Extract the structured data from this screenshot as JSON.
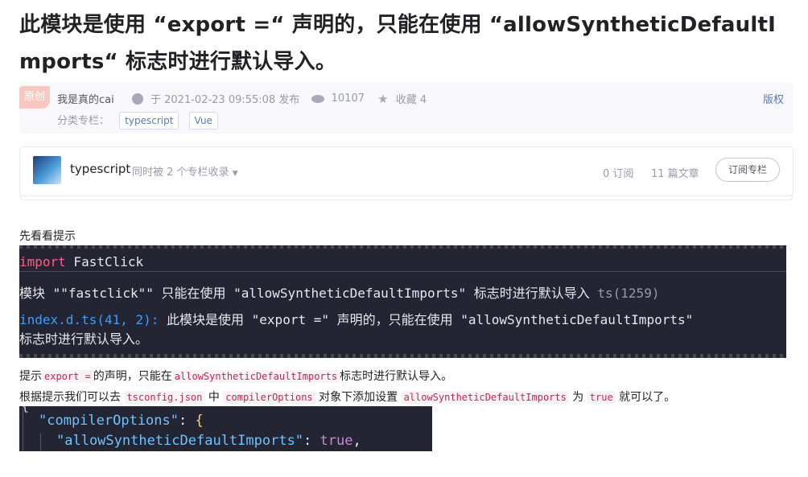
{
  "article": {
    "title": "此模块是使用 “export =“ 声明的，只能在使用 “allowSyntheticDefaultImports“ 标志时进行默认导入。"
  },
  "meta": {
    "badge": "原创",
    "author": "我是真的cai",
    "date": "于 2021-02-23 09:55:08 发布",
    "views": "10107",
    "favorites": "收藏 4",
    "copyright": "版权",
    "category_label": "分类专栏：",
    "tags": [
      "typescript",
      "Vue"
    ]
  },
  "column": {
    "name": "typescript",
    "note": "同时被 2 个专栏收录",
    "subs": "0 订阅",
    "count": "11 篇文章",
    "subscribe": "订阅专栏"
  },
  "body": {
    "intro": "先看看提示",
    "tooltip": {
      "line1_kw": "import",
      "line1_rest": " FastClick",
      "line2_main": "模块 \"\"fastclick\"\" 只能在使用 \"allowSyntheticDefaultImports\" 标志时进行默认导入 ",
      "line2_code": "ts(1259)",
      "line3_link": "index.d.ts(41, 2):",
      "line3_rest": " 此模块是使用 \"export =\" 声明的，只能在使用 \"allowSyntheticDefaultImports\"",
      "line4": "标志时进行默认导入。"
    },
    "p2": {
      "a": "提示",
      "code1": "export =",
      "b": "的声明，只能在",
      "code2": "allowSyntheticDefaultImports",
      "c": "标志时进行默认导入。"
    },
    "p3": {
      "a": "根据提示我们可以去 ",
      "code1": "tsconfig.json",
      "b": " 中 ",
      "code2": "compilerOptions",
      "c": " 对象下添加设置 ",
      "code3": "allowSyntheticDefaultImports",
      "d": " 为 ",
      "code4": "true",
      "e": " 就可以了。"
    },
    "code": {
      "brace_top": "{",
      "key1": "\"compilerOptions\"",
      "colon1": ": ",
      "brace1": "{",
      "key2": "\"allowSyntheticDefaultImports\"",
      "colon2": ": ",
      "value2": "true",
      "comma2": ","
    }
  },
  "colors": {
    "accent": "#5a7aa8",
    "code_bg": "#232532",
    "keyword": "#ff5c8a",
    "link": "#3c9cff"
  }
}
